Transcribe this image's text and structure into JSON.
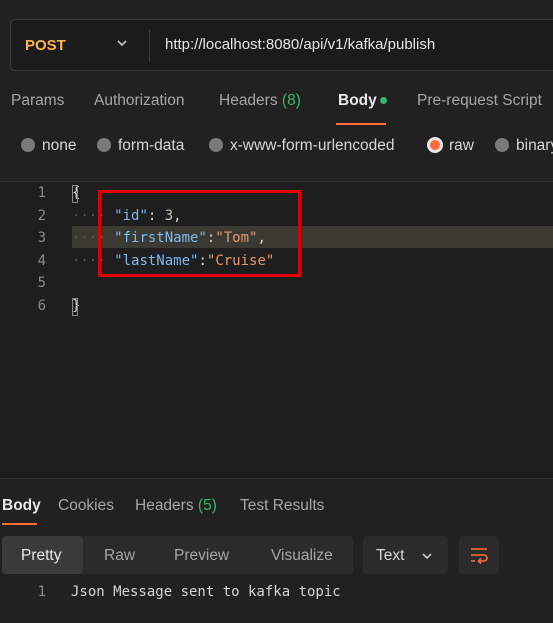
{
  "request": {
    "method": "POST",
    "url": "http://localhost:8080/api/v1/kafka/publish"
  },
  "request_tabs": {
    "params": "Params",
    "authorization": "Authorization",
    "headers": "Headers",
    "headers_count": "(8)",
    "body": "Body",
    "prerequest": "Pre-request Script"
  },
  "body_types": {
    "none": "none",
    "form_data": "form-data",
    "urlencoded": "x-www-form-urlencoded",
    "raw": "raw",
    "binary": "binary",
    "selected": "raw"
  },
  "editor": {
    "line_numbers": [
      "1",
      "2",
      "3",
      "4",
      "5",
      "6"
    ],
    "open_brace": "{",
    "close_brace": "}",
    "guide": "····",
    "lines": [
      {
        "key": "\"id\"",
        "sep": ": ",
        "value": "3",
        "value_type": "number",
        "trail": ","
      },
      {
        "key": "\"firstName\"",
        "sep": ":",
        "value": "\"Tom\"",
        "value_type": "string",
        "trail": ","
      },
      {
        "key": "\"lastName\"",
        "sep": ":",
        "value": "\"Cruise\"",
        "value_type": "string",
        "trail": ""
      }
    ],
    "highlighted_line": 3
  },
  "response_tabs": {
    "body": "Body",
    "cookies": "Cookies",
    "headers": "Headers",
    "headers_count": "(5)",
    "test_results": "Test Results"
  },
  "view_modes": {
    "pretty": "Pretty",
    "raw": "Raw",
    "preview": "Preview",
    "visualize": "Visualize",
    "format": "Text"
  },
  "response": {
    "line_number": "1",
    "text": "Json Message sent to kafka topic"
  },
  "colors": {
    "accent": "#ff6c37",
    "method": "#ffb24d",
    "success": "#3cb46e",
    "highlight_box": "#e00000"
  }
}
